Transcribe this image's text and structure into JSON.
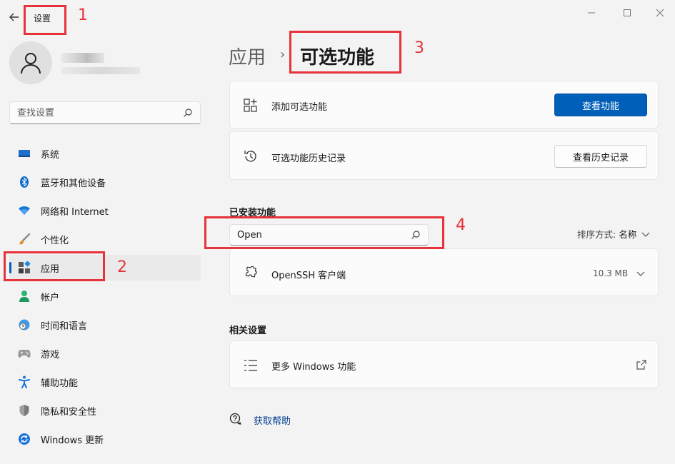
{
  "window": {
    "title": "设置"
  },
  "profile": {},
  "search": {
    "placeholder": "查找设置"
  },
  "nav": [
    {
      "label": "系统",
      "icon": "system-icon"
    },
    {
      "label": "蓝牙和其他设备",
      "icon": "bluetooth-icon"
    },
    {
      "label": "网络和 Internet",
      "icon": "wifi-icon"
    },
    {
      "label": "个性化",
      "icon": "brush-icon"
    },
    {
      "label": "应用",
      "icon": "apps-icon"
    },
    {
      "label": "帐户",
      "icon": "account-icon"
    },
    {
      "label": "时间和语言",
      "icon": "clock-globe-icon"
    },
    {
      "label": "游戏",
      "icon": "gamepad-icon"
    },
    {
      "label": "辅助功能",
      "icon": "accessibility-icon"
    },
    {
      "label": "隐私和安全性",
      "icon": "shield-icon"
    },
    {
      "label": "Windows 更新",
      "icon": "update-icon"
    }
  ],
  "breadcrumb": {
    "parent": "应用",
    "separator": "›",
    "current": "可选功能"
  },
  "cards": {
    "add": {
      "label": "添加可选功能",
      "button": "查看功能"
    },
    "history": {
      "label": "可选功能历史记录",
      "button": "查看历史记录"
    }
  },
  "installed": {
    "title": "已安装功能",
    "search_value": "Open",
    "sort_label": "排序方式:",
    "sort_value": "名称",
    "items": [
      {
        "name": "OpenSSH 客户端",
        "size": "10.3 MB"
      }
    ]
  },
  "related": {
    "title": "相关设置",
    "items": [
      {
        "label": "更多 Windows 功能"
      }
    ]
  },
  "help": {
    "label": "获取帮助"
  },
  "annotations": [
    "1",
    "2",
    "3",
    "4"
  ],
  "colors": {
    "accent": "#005fb8",
    "annotation": "#e8323a"
  }
}
